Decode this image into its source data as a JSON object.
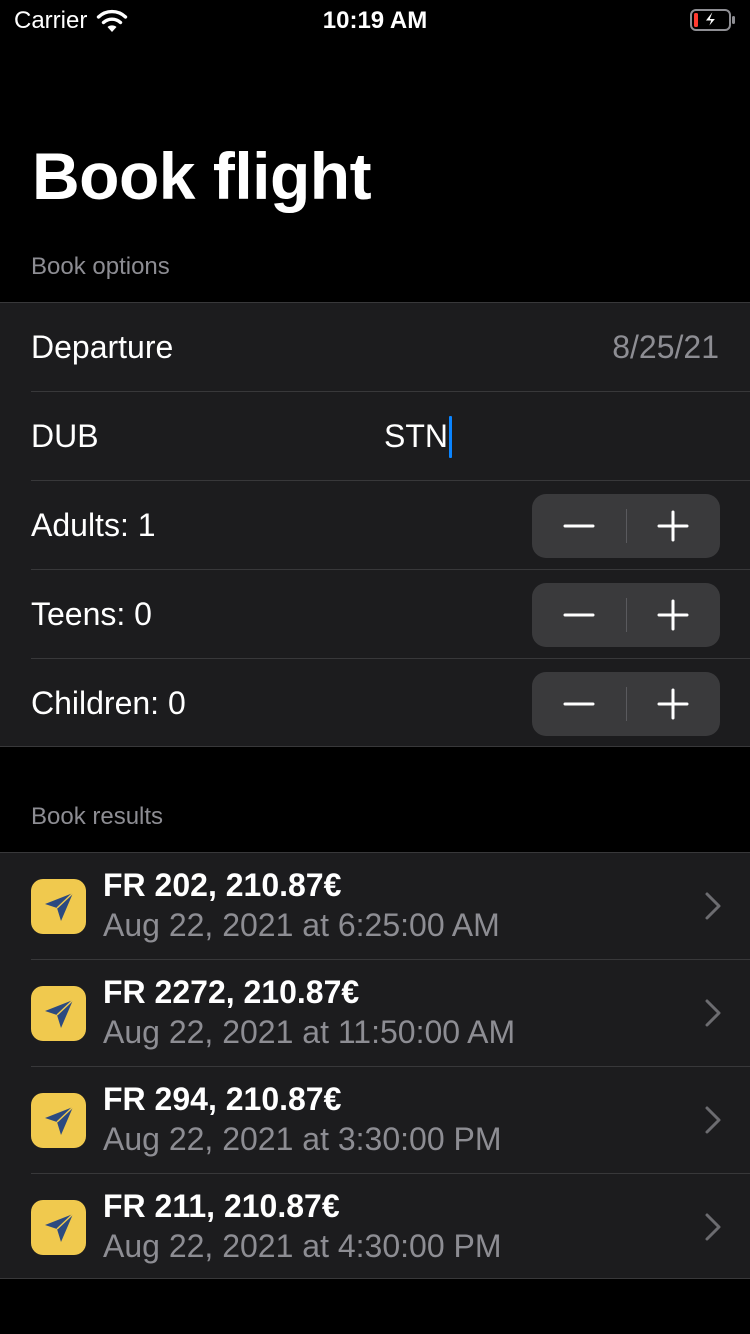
{
  "status_bar": {
    "carrier": "Carrier",
    "time": "10:19 AM",
    "icons": [
      "wifi-icon",
      "battery-charging-icon"
    ]
  },
  "title": "Book flight",
  "book_options": {
    "header": "Book options",
    "departure": {
      "label": "Departure",
      "value": "8/25/21"
    },
    "route": {
      "from": "DUB",
      "to": "STN"
    },
    "passengers": [
      {
        "label": "Adults: 1"
      },
      {
        "label": "Teens: 0"
      },
      {
        "label": "Children: 0"
      }
    ]
  },
  "book_results": {
    "header": "Book results",
    "items": [
      {
        "title": "FR 202, 210.87€",
        "subtitle": "Aug 22, 2021 at 6:25:00 AM"
      },
      {
        "title": "FR 2272, 210.87€",
        "subtitle": "Aug 22, 2021 at 11:50:00 AM"
      },
      {
        "title": "FR 294, 210.87€",
        "subtitle": "Aug 22, 2021 at 3:30:00 PM"
      },
      {
        "title": "FR 211, 210.87€",
        "subtitle": "Aug 22, 2021 at 4:30:00 PM"
      }
    ]
  },
  "colors": {
    "background": "#000000",
    "cell": "#1c1c1e",
    "secondary_text": "#8d8d93",
    "icon_bg": "#f0c94e",
    "icon_fg": "#2c4a80",
    "caret": "#0a84ff"
  }
}
